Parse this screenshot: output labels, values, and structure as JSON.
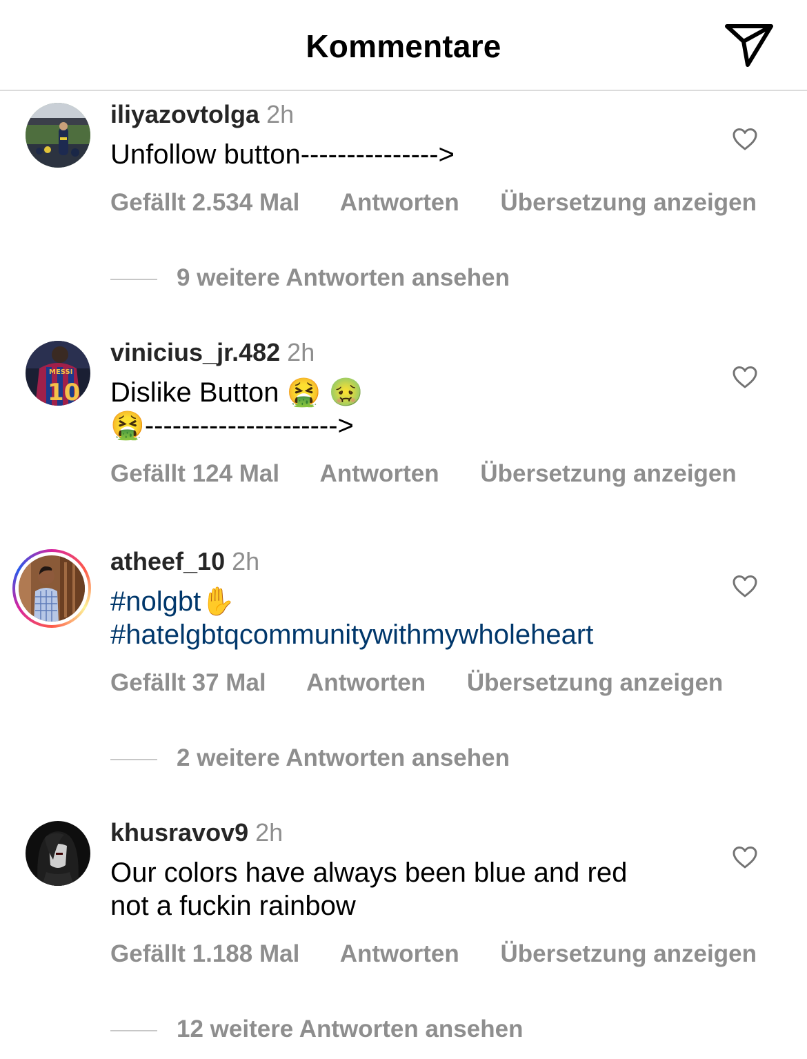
{
  "header": {
    "title": "Kommentare",
    "share_icon": "paper-plane-icon"
  },
  "comments": [
    {
      "username": "iliyazovtolga",
      "time": "2h",
      "text_line1": "Unfollow button--------------->",
      "likes": "Gefällt 2.534 Mal",
      "reply": "Antworten",
      "translate": "Übersetzung anzeigen",
      "more_replies": "9 weitere Antworten ansehen"
    },
    {
      "username": "vinicius_jr.482",
      "time": "2h",
      "text_line1": "Dislike Button ",
      "emoji_1": "🤮",
      "emoji_2": "🤢",
      "emoji_3": "🤮",
      "text_line2": "--------------------->",
      "likes": "Gefällt 124 Mal",
      "reply": "Antworten",
      "translate": "Übersetzung anzeigen"
    },
    {
      "username": "atheef_10",
      "time": "2h",
      "hashtag_1": "#nolgbt",
      "emoji_1": "✋",
      "hashtag_2": "#hatelgbtqcommunitywithmywholeheart",
      "likes": "Gefällt 37 Mal",
      "reply": "Antworten",
      "translate": "Übersetzung anzeigen",
      "more_replies": "2 weitere Antworten ansehen"
    },
    {
      "username": "khusravov9",
      "time": "2h",
      "text_line1": "Our colors have always been blue and red",
      "text_line2": "not a fuckin rainbow",
      "likes": "Gefällt 1.188 Mal",
      "reply": "Antworten",
      "translate": "Übersetzung anzeigen",
      "more_replies": "12 weitere Antworten ansehen"
    }
  ],
  "colors": {
    "username": "#262626",
    "secondary": "#8e8e8e",
    "hashtag": "#00376b",
    "divider": "#dbdbdb"
  }
}
